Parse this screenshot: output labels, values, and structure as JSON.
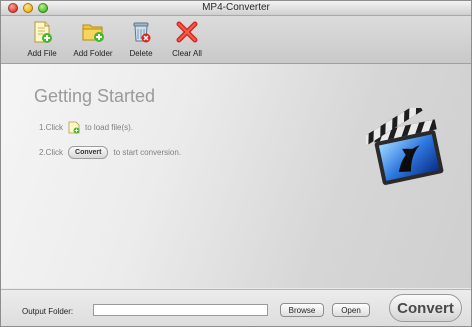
{
  "window": {
    "title": "MP4-Converter"
  },
  "toolbar": {
    "items": [
      {
        "label": "Add File",
        "icon": "add-file-icon"
      },
      {
        "label": "Add Folder",
        "icon": "add-folder-icon"
      },
      {
        "label": "Delete",
        "icon": "delete-icon"
      },
      {
        "label": "Clear All",
        "icon": "clear-all-icon"
      }
    ]
  },
  "main": {
    "heading": "Getting Started",
    "step1": {
      "prefix": "1.Click",
      "suffix": "to load file(s)."
    },
    "step2": {
      "prefix": "2.Click",
      "button": "Convert",
      "suffix": "to start conversion."
    }
  },
  "bottom": {
    "output_label": "Output Folder:",
    "output_value": "",
    "browse_label": "Browse",
    "open_label": "Open",
    "convert_label": "Convert"
  },
  "colors": {
    "accent_green": "#44b82c",
    "delete_red": "#d8261c"
  }
}
